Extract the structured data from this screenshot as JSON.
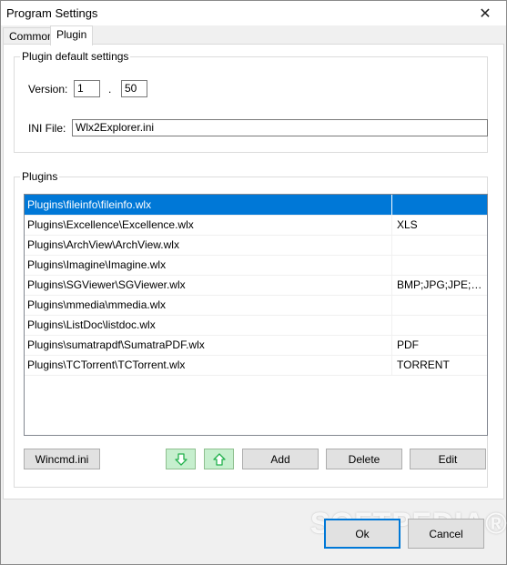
{
  "window": {
    "title": "Program Settings",
    "close_glyph": "✕"
  },
  "tabs": [
    {
      "label": "Common",
      "active": false
    },
    {
      "label": "Plugin",
      "active": true
    }
  ],
  "plugin_defaults": {
    "legend": "Plugin default settings",
    "version_label": "Version:",
    "version_major": "1",
    "version_separator": ".",
    "version_minor": "50",
    "ini_label": "INI File:",
    "ini_value": "Wlx2Explorer.ini"
  },
  "plugins": {
    "legend": "Plugins",
    "rows": [
      {
        "path": "Plugins\\fileinfo\\fileinfo.wlx",
        "ext": ""
      },
      {
        "path": "Plugins\\Excellence\\Excellence.wlx",
        "ext": "XLS"
      },
      {
        "path": "Plugins\\ArchView\\ArchView.wlx",
        "ext": ""
      },
      {
        "path": "Plugins\\Imagine\\Imagine.wlx",
        "ext": ""
      },
      {
        "path": "Plugins\\SGViewer\\SGViewer.wlx",
        "ext": "BMP;JPG;JPE;JPEG;PNG"
      },
      {
        "path": "Plugins\\mmedia\\mmedia.wlx",
        "ext": ""
      },
      {
        "path": "Plugins\\ListDoc\\listdoc.wlx",
        "ext": ""
      },
      {
        "path": "Plugins\\sumatrapdf\\SumatraPDF.wlx",
        "ext": "PDF"
      },
      {
        "path": "Plugins\\TCTorrent\\TCTorrent.wlx",
        "ext": "TORRENT"
      }
    ],
    "selected_index": 0
  },
  "buttons": {
    "wincmd": "Wincmd.ini",
    "add": "Add",
    "delete": "Delete",
    "edit": "Edit",
    "ok": "Ok",
    "cancel": "Cancel"
  },
  "icons": {
    "move_down": "arrow-down-icon",
    "move_up": "arrow-up-icon",
    "arrow_color": "#22b14c",
    "arrow_btn_bg": "#c6efce"
  },
  "colors": {
    "selection": "#0078d7",
    "default_button_border": "#0078d7"
  },
  "watermark": "SOFTPEDIA®"
}
